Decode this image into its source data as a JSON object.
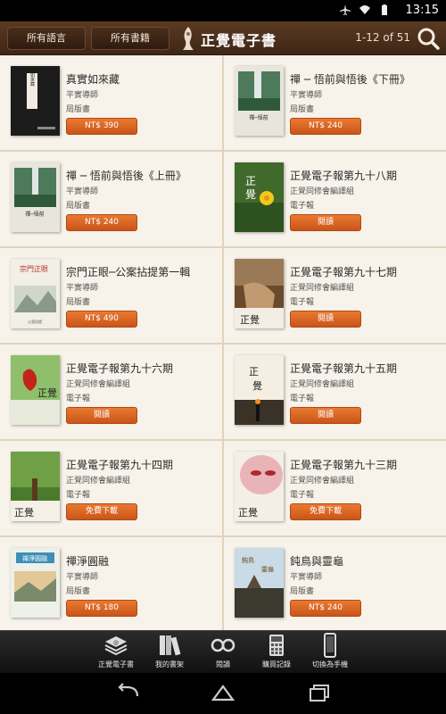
{
  "status_bar": {
    "time": "13:15"
  },
  "header": {
    "lang_button": "所有語言",
    "category_button": "所有書籍",
    "title": "正覺電子書",
    "count": "1-12 of 51"
  },
  "books": [
    {
      "title": "真實如來藏",
      "author": "平實導師",
      "type": "局版書",
      "action": "NT$ 390"
    },
    {
      "title": "禪 ─ 悟前與悟後《下冊》",
      "author": "平實導師",
      "type": "局版書",
      "action": "NT$ 240"
    },
    {
      "title": "禪 ─ 悟前與悟後《上冊》",
      "author": "平實導師",
      "type": "局版書",
      "action": "NT$ 240"
    },
    {
      "title": "正覺電子報第九十八期",
      "author": "正覺同修會編譯組",
      "type": "電子報",
      "action": "閱讀"
    },
    {
      "title": "宗門正眼─公案拈提第一輯",
      "author": "平實導師",
      "type": "局版書",
      "action": "NT$ 490"
    },
    {
      "title": "正覺電子報第九十七期",
      "author": "正覺同修會編譯組",
      "type": "電子報",
      "action": "閱讀"
    },
    {
      "title": "正覺電子報第九十六期",
      "author": "正覺同修會編譯組",
      "type": "電子報",
      "action": "閱讀"
    },
    {
      "title": "正覺電子報第九十五期",
      "author": "正覺同修會編譯組",
      "type": "電子報",
      "action": "閱讀"
    },
    {
      "title": "正覺電子報第九十四期",
      "author": "正覺同修會編譯組",
      "type": "電子報",
      "action": "免費下載"
    },
    {
      "title": "正覺電子報第九十三期",
      "author": "正覺同修會編譯組",
      "type": "電子報",
      "action": "免費下載"
    },
    {
      "title": "禪淨圓融",
      "author": "平實導師",
      "type": "局版書",
      "action": "NT$ 180"
    },
    {
      "title": "鈍鳥與靈龜",
      "author": "平實導師",
      "type": "局版書",
      "action": "NT$ 240"
    }
  ],
  "covers": {
    "c1_text": "真實如來藏",
    "c3_text": "禪─悟前與悟後",
    "c5_text": "宗門正眼",
    "c11_text": "禪淨圓融",
    "c12_text": "鈍鳥與靈龜",
    "paper_text": "正覺"
  },
  "tabs": [
    {
      "label": "正覺電子書",
      "icon": "ebook-icon"
    },
    {
      "label": "我的書架",
      "icon": "bookshelf-icon"
    },
    {
      "label": "閱讀",
      "icon": "glasses-icon"
    },
    {
      "label": "購買記錄",
      "icon": "calculator-icon"
    },
    {
      "label": "切換為手機",
      "icon": "phone-icon"
    }
  ],
  "colors": {
    "accent": "#d9622a",
    "header": "#4a2e1a",
    "list_bg": "#f3ece3"
  }
}
